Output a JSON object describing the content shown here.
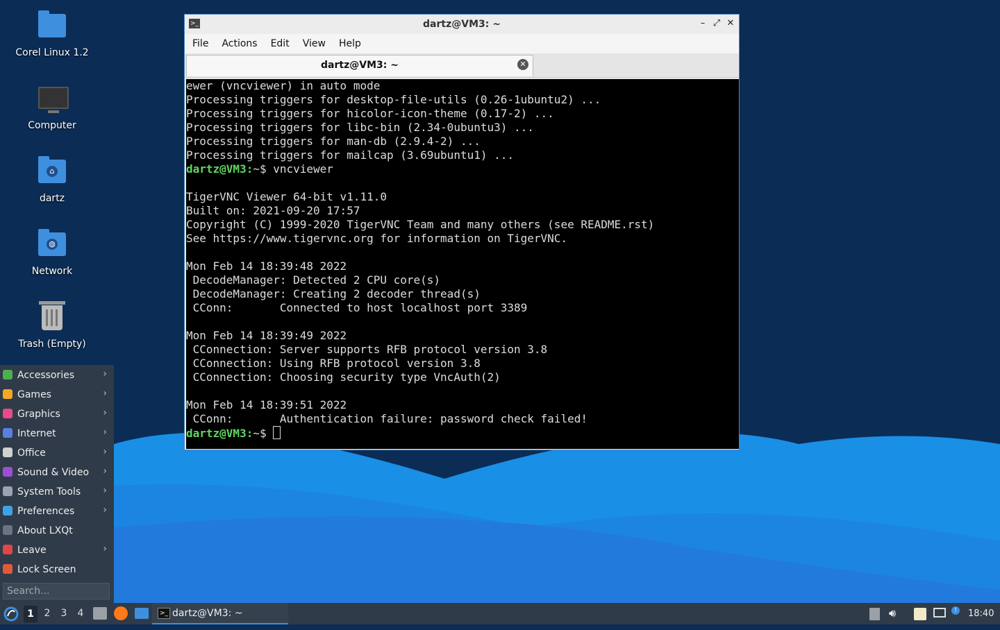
{
  "desktop": {
    "icons": [
      {
        "label": "Corel Linux 1.2"
      },
      {
        "label": "Computer"
      },
      {
        "label": "dartz"
      },
      {
        "label": "Network"
      },
      {
        "label": "Trash (Empty)"
      }
    ]
  },
  "terminal": {
    "title": "dartz@VM3: ~",
    "menu": [
      "File",
      "Actions",
      "Edit",
      "View",
      "Help"
    ],
    "tab_title": "dartz@VM3: ~",
    "prompt": "dartz@VM3:",
    "prompt_suffix": "~$ ",
    "lines_before": [
      "ewer (vncviewer) in auto mode",
      "Processing triggers for desktop-file-utils (0.26-1ubuntu2) ...",
      "Processing triggers for hicolor-icon-theme (0.17-2) ...",
      "Processing triggers for libc-bin (2.34-0ubuntu3) ...",
      "Processing triggers for man-db (2.9.4-2) ...",
      "Processing triggers for mailcap (3.69ubuntu1) ..."
    ],
    "command": "vncviewer",
    "lines_after": [
      "",
      "TigerVNC Viewer 64-bit v1.11.0",
      "Built on: 2021-09-20 17:57",
      "Copyright (C) 1999-2020 TigerVNC Team and many others (see README.rst)",
      "See https://www.tigervnc.org for information on TigerVNC.",
      "",
      "Mon Feb 14 18:39:48 2022",
      " DecodeManager: Detected 2 CPU core(s)",
      " DecodeManager: Creating 2 decoder thread(s)",
      " CConn:       Connected to host localhost port 3389",
      "",
      "Mon Feb 14 18:39:49 2022",
      " CConnection: Server supports RFB protocol version 3.8",
      " CConnection: Using RFB protocol version 3.8",
      " CConnection: Choosing security type VncAuth(2)",
      "",
      "Mon Feb 14 18:39:51 2022",
      " CConn:       Authentication failure: password check failed!"
    ]
  },
  "start_menu": {
    "items": [
      {
        "label": "Accessories",
        "submenu": true,
        "icon": "accessories-icon",
        "color": "#4caf50"
      },
      {
        "label": "Games",
        "submenu": true,
        "icon": "games-icon",
        "color": "#f5a623"
      },
      {
        "label": "Graphics",
        "submenu": true,
        "icon": "graphics-icon",
        "color": "#e94b8a"
      },
      {
        "label": "Internet",
        "submenu": true,
        "icon": "internet-icon",
        "color": "#5b7fe0"
      },
      {
        "label": "Office",
        "submenu": true,
        "icon": "office-icon",
        "color": "#d0d0d0"
      },
      {
        "label": "Sound & Video",
        "submenu": true,
        "icon": "sound-video-icon",
        "color": "#9c4fd6"
      },
      {
        "label": "System Tools",
        "submenu": true,
        "icon": "system-tools-icon",
        "color": "#9aa4ae"
      },
      {
        "label": "Preferences",
        "submenu": true,
        "icon": "preferences-icon",
        "color": "#3ea2e8"
      },
      {
        "label": "About LXQt",
        "submenu": false,
        "icon": "info-icon",
        "color": "#6b7580"
      },
      {
        "label": "Leave",
        "submenu": true,
        "icon": "power-icon",
        "color": "#e04646"
      },
      {
        "label": "Lock Screen",
        "submenu": false,
        "icon": "lock-icon",
        "color": "#e05a3a"
      }
    ],
    "search_placeholder": "Search..."
  },
  "taskbar": {
    "desktops": [
      "1",
      "2",
      "3",
      "4"
    ],
    "active_desktop": "1",
    "task_label": "dartz@VM3: ~",
    "clock": "18:40"
  }
}
